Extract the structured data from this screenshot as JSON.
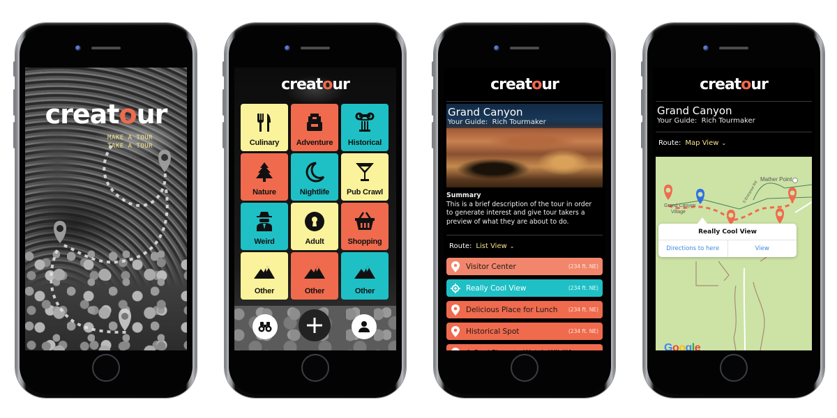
{
  "brand": {
    "name_prefix": "creat",
    "name_pin": "o",
    "name_suffix": "ur",
    "colors": {
      "orange": "#f06a4e",
      "yellow": "#fbf39b",
      "teal": "#1fc0c5",
      "accent_text": "#f3e58d",
      "map_blue": "#2f6fe4"
    }
  },
  "screen1": {
    "taglines": [
      "MAKE A TOUR",
      "TAKE A TOUR"
    ],
    "icons": [
      "map-pin-icon",
      "map-pin-icon",
      "map-pin-icon"
    ]
  },
  "screen2": {
    "categories": [
      {
        "label": "Culinary",
        "icon": "fork-knife-icon",
        "color": "yellow"
      },
      {
        "label": "Adventure",
        "icon": "backpack-icon",
        "color": "orange"
      },
      {
        "label": "Historical",
        "icon": "column-icon",
        "color": "teal"
      },
      {
        "label": "Nature",
        "icon": "tree-icon",
        "color": "orange"
      },
      {
        "label": "Nightlife",
        "icon": "moon-icon",
        "color": "teal"
      },
      {
        "label": "Pub Crawl",
        "icon": "cocktail-icon",
        "color": "yellow"
      },
      {
        "label": "Weird",
        "icon": "spy-icon",
        "color": "teal"
      },
      {
        "label": "Adult",
        "icon": "keyhole-icon",
        "color": "yellow"
      },
      {
        "label": "Shopping",
        "icon": "basket-icon",
        "color": "orange"
      },
      {
        "label": "Other",
        "icon": "mountain-icon",
        "color": "yellow"
      },
      {
        "label": "Other",
        "icon": "mountain-icon",
        "color": "orange"
      },
      {
        "label": "Other",
        "icon": "mountain-icon",
        "color": "teal"
      }
    ],
    "bottom_nav": [
      "binoculars-icon",
      "plus-icon",
      "user-icon"
    ]
  },
  "screen3": {
    "title": "Grand Canyon",
    "guide_label": "Your Guide:",
    "guide_name": "Rich Tourmaker",
    "summary_heading": "Summary",
    "summary_text": "This is a brief description of the tour in order to generate interest and give tour takers a preview of what they are about to do.",
    "route_label": "Route:",
    "route_value": "List View",
    "stops": [
      {
        "name": "Visitor Center",
        "distance": "(234 ft. NE)",
        "state": "visited"
      },
      {
        "name": "Really Cool View",
        "distance": "(234 ft. NE)",
        "state": "active"
      },
      {
        "name": "Delicious Place for Lunch",
        "distance": "(234 ft. NE)",
        "state": "upcoming"
      },
      {
        "name": "Historical Spot",
        "distance": "(234 ft. NE)",
        "state": "upcoming"
      },
      {
        "name": "A Cool Place to Watch Wildlife",
        "distance": "",
        "state": "upcoming"
      }
    ]
  },
  "screen4": {
    "title": "Grand Canyon",
    "guide_label": "Your Guide:",
    "guide_name": "Rich Tourmaker",
    "route_label": "Route:",
    "route_value": "Map View",
    "map": {
      "labels": [
        "Mather Point",
        "Grand Canyon",
        "Village",
        "S Entrance Rd"
      ],
      "popup_title": "Really Cool View",
      "popup_directions": "Directions to here",
      "popup_view": "View",
      "attribution": "Google"
    }
  }
}
